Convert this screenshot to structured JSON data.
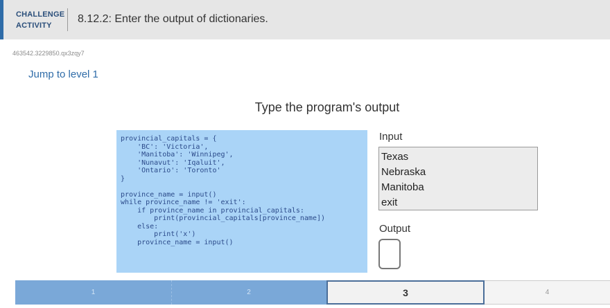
{
  "header": {
    "challenge_line1": "CHALLENGE",
    "challenge_line2": "ACTIVITY",
    "title": "8.12.2: Enter the output of dictionaries."
  },
  "activity_id": "463542.3229850.qx3zqy7",
  "jump_link": "Jump to level 1",
  "prompt": "Type the program's output",
  "code": "provincial_capitals = {\n    'BC': 'Victoria',\n    'Manitoba': 'Winnipeg',\n    'Nunavut': 'Iqaluit',\n    'Ontario': 'Toronto'\n}\n\nprovince_name = input()\nwhile province_name != 'exit':\n    if province_name in provincial_capitals:\n        print(provincial_capitals[province_name])\n    else:\n        print('x')\n    province_name = input()",
  "input_label": "Input",
  "input_lines": [
    "Texas",
    "Nebraska",
    "Manitoba",
    "exit"
  ],
  "output_label": "Output",
  "output_value": "",
  "levels": [
    "1",
    "2",
    "3",
    "4"
  ],
  "current_level": 3,
  "colors": {
    "accent": "#2f6ca8",
    "code_bg": "#aad4f7",
    "level_done": "#7aa8d8",
    "level_current_border": "#4a6e99"
  }
}
